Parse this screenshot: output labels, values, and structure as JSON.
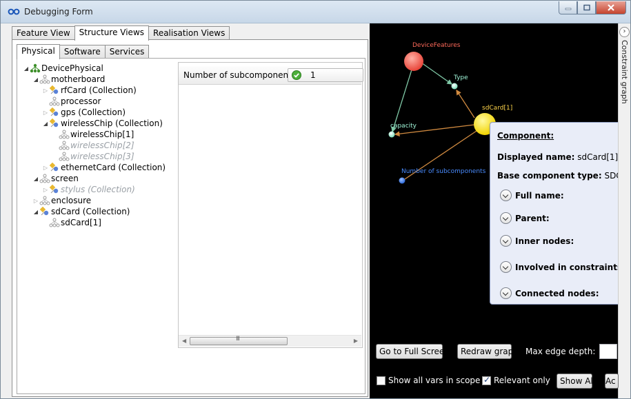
{
  "window": {
    "title": "Debugging Form"
  },
  "outer_tabs": [
    "Feature View",
    "Structure Views",
    "Realisation Views"
  ],
  "inner_tabs": [
    "Physical",
    "Software",
    "Services"
  ],
  "tree": [
    {
      "label": "DevicePhysical",
      "level": 0,
      "expander": "expanded",
      "icon": "root-structure",
      "dim": false
    },
    {
      "label": "motherboard",
      "level": 1,
      "expander": "expanded",
      "icon": "structure",
      "dim": false
    },
    {
      "label": "rfCard (Collection)",
      "level": 2,
      "expander": "collapsed",
      "icon": "collection",
      "dim": false
    },
    {
      "label": "processor",
      "level": 2,
      "expander": "none",
      "icon": "structure",
      "dim": false
    },
    {
      "label": "gps (Collection)",
      "level": 2,
      "expander": "collapsed",
      "icon": "collection",
      "dim": false
    },
    {
      "label": "wirelessChip (Collection)",
      "level": 2,
      "expander": "expanded",
      "icon": "collection",
      "dim": false
    },
    {
      "label": "wirelessChip[1]",
      "level": 3,
      "expander": "none",
      "icon": "structure",
      "dim": false
    },
    {
      "label": "wirelessChip[2]",
      "level": 3,
      "expander": "none",
      "icon": "structure",
      "dim": true
    },
    {
      "label": "wirelessChip[3]",
      "level": 3,
      "expander": "none",
      "icon": "structure",
      "dim": true
    },
    {
      "label": "ethernetCard (Collection)",
      "level": 2,
      "expander": "collapsed",
      "icon": "collection",
      "dim": false
    },
    {
      "label": "screen",
      "level": 1,
      "expander": "expanded",
      "icon": "structure",
      "dim": false
    },
    {
      "label": "stylus (Collection)",
      "level": 2,
      "expander": "collapsed",
      "icon": "collection",
      "dim": true
    },
    {
      "label": "enclosure",
      "level": 1,
      "expander": "collapsed",
      "icon": "structure",
      "dim": false
    },
    {
      "label": "sdCard (Collection)",
      "level": 1,
      "expander": "expanded",
      "icon": "collection",
      "dim": false
    },
    {
      "label": "sdCard[1]",
      "level": 2,
      "expander": "none",
      "icon": "structure",
      "dim": false
    }
  ],
  "property_grid": {
    "label": "Number of subcomponents",
    "value": "1",
    "status_icon": "check-icon",
    "scroll_grip": "III"
  },
  "graph": {
    "nodes": [
      {
        "label": "DeviceFeatures",
        "color": "#f0504a",
        "label_color": "#ff6a5a"
      },
      {
        "label": "Type",
        "color": "#9df0d0",
        "label_color": "#9ff5d8"
      },
      {
        "label": "sdCard[1]",
        "color": "#ffe800",
        "label_color": "#ffd54a"
      },
      {
        "label": "capacity",
        "color": "#9df0d0",
        "label_color": "#9ff5d8"
      },
      {
        "label": "Number of subcomponents",
        "color": "#3a7fe8",
        "label_color": "#4a8cff"
      }
    ],
    "edge_colors": {
      "features": "#7fc8a6",
      "component": "#d08a40"
    }
  },
  "popup": {
    "title": "Component:",
    "displayed_name_label": "Displayed name:",
    "displayed_name": "sdCard[1]",
    "base_type_label": "Base component type:",
    "base_type": "SDCard",
    "sections": [
      "Full name:",
      "Parent:",
      "Inner nodes:",
      "Involved in constraints:",
      "Connected nodes:"
    ]
  },
  "side_panel": {
    "label": "Constraint graph",
    "expand_glyph": "›"
  },
  "controls": {
    "full_screen": "Go to Full Screen",
    "redraw": "Redraw graph",
    "max_depth_label": "Max edge depth:",
    "show_all_vars": "Show all vars in scope",
    "show_all_vars_checked": false,
    "relevant_only": "Relevant only",
    "relevant_only_checked": true,
    "show_all": "Show All",
    "truncated_button": "Ac"
  }
}
